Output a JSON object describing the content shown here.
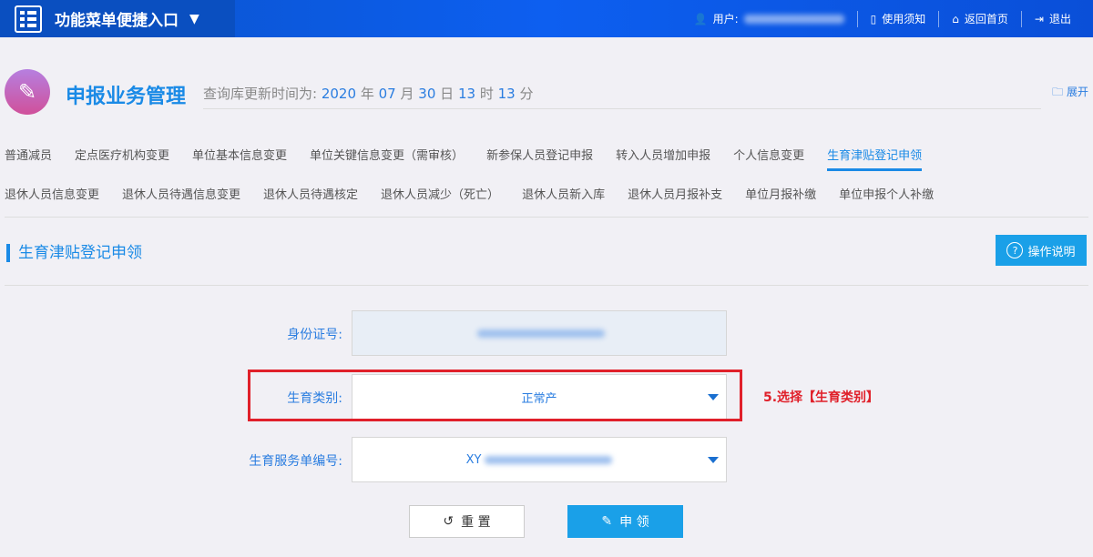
{
  "topbar": {
    "menu_label": "功能菜单便捷入口",
    "user_label": "用户:",
    "guide": "使用须知",
    "home": "返回首页",
    "logout": "退出"
  },
  "header": {
    "title": "申报业务管理",
    "update_prefix": "查询库更新时间为:",
    "year": "2020",
    "y": "年",
    "month": "07",
    "m": "月",
    "day": "30",
    "d": "日",
    "hour": "13",
    "h": "时",
    "minute": "13",
    "mi": "分",
    "expand": "展开"
  },
  "tabs_row1": [
    "普通减员",
    "定点医疗机构变更",
    "单位基本信息变更",
    "单位关键信息变更（需审核）",
    "新参保人员登记申报",
    "转入人员增加申报",
    "个人信息变更",
    "生育津贴登记申领"
  ],
  "tabs_row2": [
    "退休人员信息变更",
    "退休人员待遇信息变更",
    "退休人员待遇核定",
    "退休人员减少（死亡）",
    "退休人员新入库",
    "退休人员月报补支",
    "单位月报补缴",
    "单位申报个人补缴"
  ],
  "section": {
    "title": "生育津贴登记申领",
    "help": "操作说明"
  },
  "form": {
    "id_label": "身份证号:",
    "type_label": "生育类别:",
    "type_value": "正常产",
    "service_label": "生育服务单编号:",
    "service_prefix": "XY"
  },
  "annotation": "5.选择【生育类别】",
  "buttons": {
    "reset": "重 置",
    "apply": "申 领"
  }
}
